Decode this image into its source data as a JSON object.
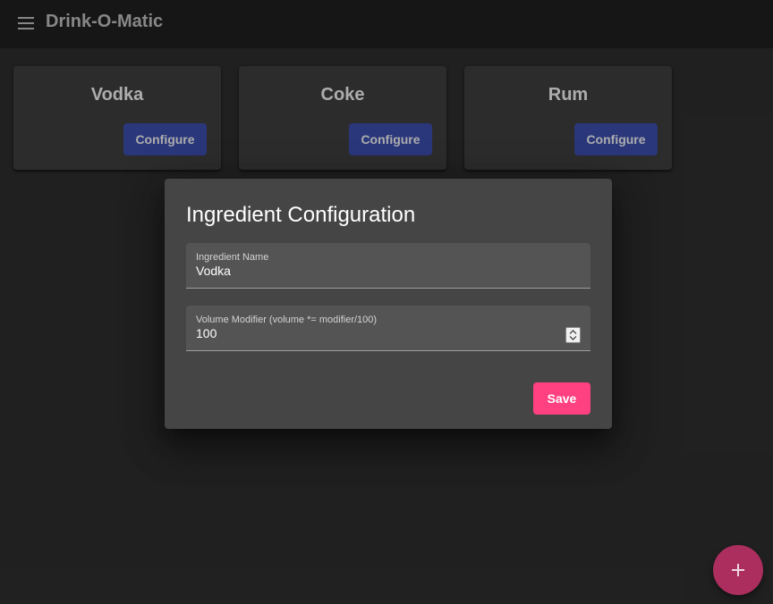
{
  "app": {
    "title": "Drink-O-Matic"
  },
  "cards": [
    {
      "name": "Vodka",
      "button_label": "Configure"
    },
    {
      "name": "Coke",
      "button_label": "Configure"
    },
    {
      "name": "Rum",
      "button_label": "Configure"
    }
  ],
  "dialog": {
    "title": "Ingredient Configuration",
    "name_field": {
      "label": "Ingredient Name",
      "value": "Vodka"
    },
    "modifier_field": {
      "label": "Volume Modifier (volume *= modifier/100)",
      "value": "100"
    },
    "save_label": "Save"
  },
  "fab": {
    "icon": "plus-icon"
  },
  "colors": {
    "appbar": "#212121",
    "card": "#424242",
    "dialog": "#454545",
    "primary": "#3f51b5",
    "accent": "#ff4081"
  }
}
